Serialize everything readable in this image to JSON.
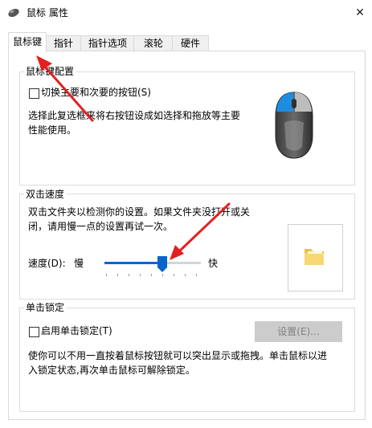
{
  "window": {
    "title": "鼠标 属性",
    "close_glyph": "✕"
  },
  "tabs": [
    {
      "label": "鼠标键",
      "active": true
    },
    {
      "label": "指针",
      "active": false
    },
    {
      "label": "指针选项",
      "active": false
    },
    {
      "label": "滚轮",
      "active": false
    },
    {
      "label": "硬件",
      "active": false
    }
  ],
  "button_config": {
    "group_label": "鼠标键配置",
    "checkbox_label": "切换主要和次要的按钮(S)",
    "checked": false,
    "description_line1": "选择此复选框来将右按钮设成如选择和拖放等主要",
    "description_line2": "性能使用。"
  },
  "double_click": {
    "group_label": "双击速度",
    "description_line1": "双击文件夹以检测你的设置。如果文件夹没打开或关",
    "description_line2": "闭，请用慢一点的设置再试一次。",
    "speed_label": "速度(D):",
    "slow_label": "慢",
    "fast_label": "快",
    "slider_value": 0.6
  },
  "click_lock": {
    "group_label": "单击锁定",
    "checkbox_label": "启用单击锁定(T)",
    "checked": false,
    "settings_button": "设置(E)...",
    "description_line1": "使你可以不用一直按着鼠标按钮就可以突出显示或拖拽。单击鼠标以进",
    "description_line2": "入锁定状态,再次单击鼠标可解除锁定。"
  },
  "colors": {
    "accent": "#0a64c9",
    "annotation_arrow": "#e32020",
    "mouse_highlight": "#1e8de0"
  },
  "icons": {
    "app": "mouse-icon",
    "close": "close-icon",
    "mouse_illustration": "mouse-illustration",
    "folder": "folder-icon"
  }
}
